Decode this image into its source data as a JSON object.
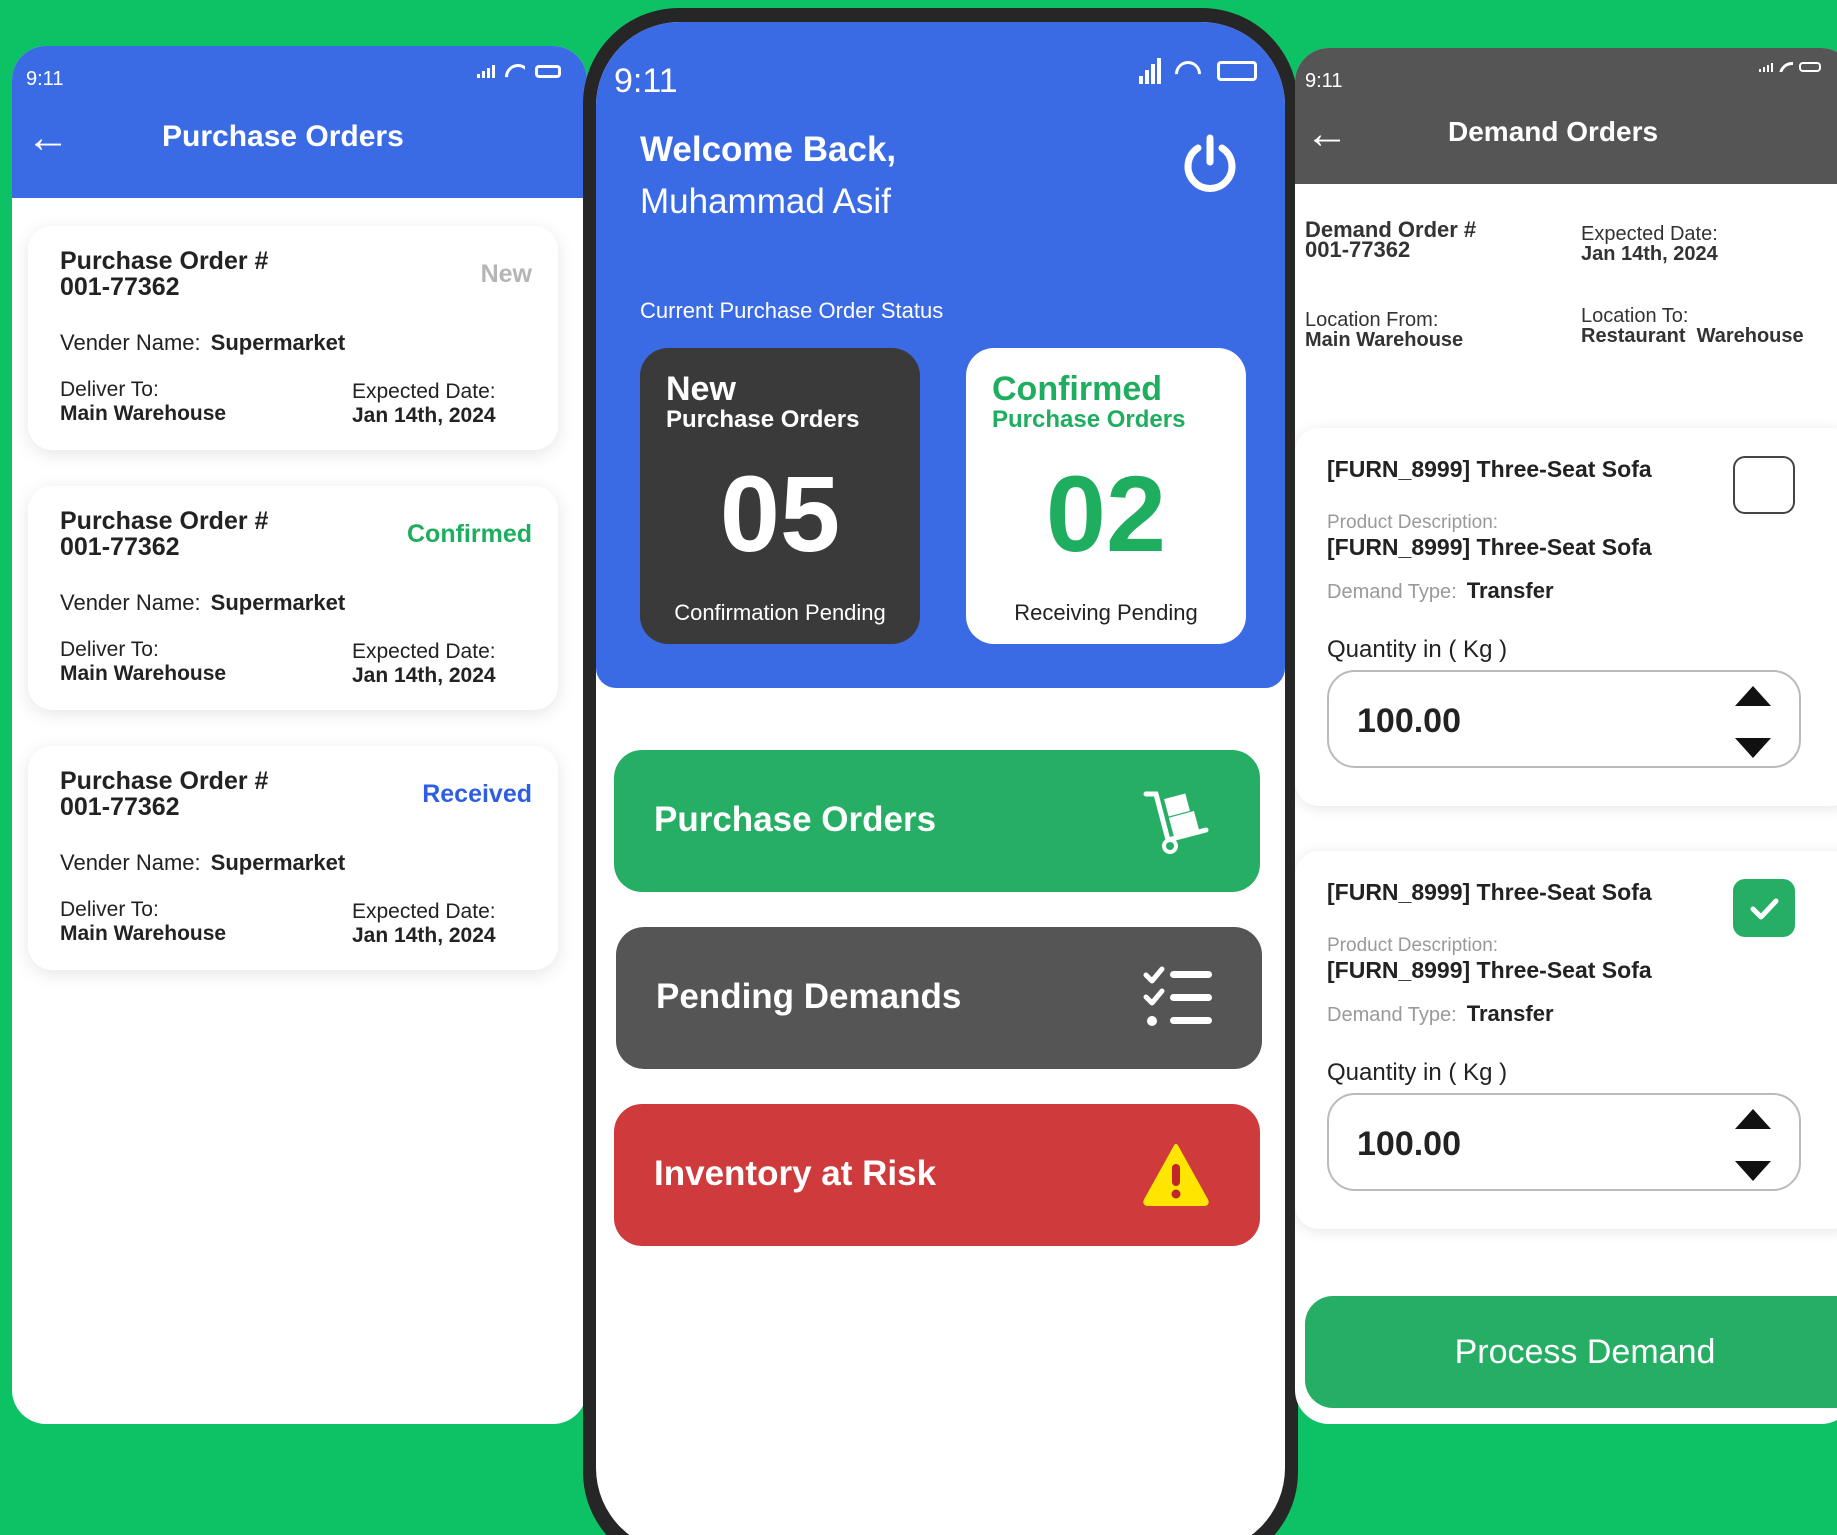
{
  "left": {
    "status_time": "9:11",
    "title": "Purchase Orders",
    "labels": {
      "po_number": "Purchase Order #",
      "vendor": "Vender Name:",
      "deliver_to": "Deliver To:",
      "expected": "Expected Date:"
    },
    "orders": [
      {
        "number": "001-77362",
        "status": "New",
        "status_color": "#b5b5b5",
        "vendor": "Supermarket",
        "deliver_to": "Main Warehouse",
        "expected": "Jan 14th, 2024"
      },
      {
        "number": "001-77362",
        "status": "Confirmed",
        "status_color": "#1fae5f",
        "vendor": "Supermarket",
        "deliver_to": "Main Warehouse",
        "expected": "Jan 14th, 2024"
      },
      {
        "number": "001-77362",
        "status": "Received",
        "status_color": "#2f5fe0",
        "vendor": "Supermarket",
        "deliver_to": "Main Warehouse",
        "expected": "Jan 14th, 2024"
      }
    ]
  },
  "center": {
    "status_time": "9:11",
    "welcome": "Welcome Back,",
    "user_name": "Muhammad Asif",
    "status_caption": "Current Purchase Order Status",
    "cards": {
      "new": {
        "title": "New",
        "subtitle": "Purchase Orders",
        "count": "05",
        "footer": "Confirmation Pending"
      },
      "confirmed": {
        "title": "Confirmed",
        "subtitle": "Purchase Orders",
        "count": "02",
        "footer": "Receiving Pending"
      }
    },
    "menu": {
      "purchase_orders": "Purchase Orders",
      "pending_demands": "Pending Demands",
      "inventory_risk": "Inventory at Risk"
    }
  },
  "right": {
    "status_time": "9:11",
    "title": "Demand Orders",
    "demand_order_label": "Demand Order #",
    "demand_order_value": "001-77362",
    "expected_label": "Expected Date:",
    "expected_value": "Jan 14th, 2024",
    "location_from_label": "Location From:",
    "location_from_value": "Main Warehouse",
    "location_to_label": "Location To:",
    "location_to_value": "Restaurant  Warehouse",
    "items": [
      {
        "product": "[FURN_8999] Three-Seat Sofa",
        "desc_label": "Product Description:",
        "desc": "[FURN_8999] Three-Seat Sofa",
        "type_label": "Demand Type:",
        "type": "Transfer",
        "qty_label": "Quantity in ( Kg )",
        "qty": "100.00",
        "checked": false
      },
      {
        "product": "[FURN_8999] Three-Seat Sofa",
        "desc_label": "Product Description:",
        "desc": "[FURN_8999] Three-Seat Sofa",
        "type_label": "Demand Type:",
        "type": "Transfer",
        "qty_label": "Quantity in ( Kg )",
        "qty": "100.00",
        "checked": true
      }
    ],
    "process_button": "Process Demand"
  },
  "colors": {
    "background": "#0dc165",
    "blue": "#3b6be4",
    "dark_card": "#3a3a3a",
    "green": "#27ae65",
    "confirmed_green": "#1fae5f",
    "gray_button": "#555555",
    "red": "#cf3a3c",
    "warning_yellow": "#ffe600"
  }
}
